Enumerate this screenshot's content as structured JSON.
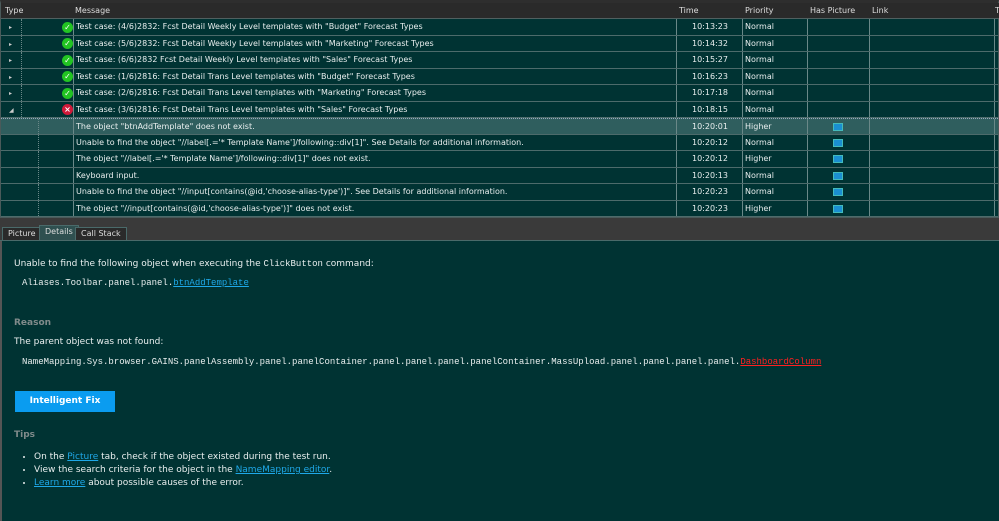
{
  "columns": [
    "Type",
    "Message",
    "Time",
    "Priority",
    "Has Picture",
    "Link",
    "T"
  ],
  "rows": [
    {
      "status": "pass",
      "message": "Test case: (4/6)2832: Fcst Detail Weekly Level templates with \"Budget\" Forecast Types",
      "time": "10:13:23",
      "priority": "Normal",
      "level": 0,
      "expander": "collapsed"
    },
    {
      "status": "pass",
      "message": "Test case: (5/6)2832: Fcst Detail Weekly Level templates with \"Marketing\" Forecast Types",
      "time": "10:14:32",
      "priority": "Normal",
      "level": 0,
      "expander": "collapsed"
    },
    {
      "status": "pass",
      "message": "Test case: (6/6)2832 Fcst Detail Weekly Level templates with \"Sales\" Forecast Types",
      "time": "10:15:27",
      "priority": "Normal",
      "level": 0,
      "expander": "collapsed"
    },
    {
      "status": "pass",
      "message": "Test case: (1/6)2816: Fcst Detail Trans Level templates with \"Budget\" Forecast Types",
      "time": "10:16:23",
      "priority": "Normal",
      "level": 0,
      "expander": "collapsed"
    },
    {
      "status": "pass",
      "message": "Test case: (2/6)2816: Fcst Detail Trans Level templates with \"Marketing\" Forecast Types",
      "time": "10:17:18",
      "priority": "Normal",
      "level": 0,
      "expander": "collapsed"
    },
    {
      "status": "error",
      "message": "Test case: (3/6)2816: Fcst Detail Trans Level templates with \"Sales\" Forecast Types",
      "time": "10:18:15",
      "priority": "Normal",
      "level": 0,
      "expander": "expanded"
    },
    {
      "status": "error",
      "message": "The object \"btnAddTemplate\" does not exist.",
      "time": "10:20:01",
      "priority": "Higher",
      "level": 1,
      "picture": true,
      "selected": true
    },
    {
      "status": "error",
      "message": "Unable to find the object \"//label[.='* Template Name']/following::div[1]\". See Details for additional information.",
      "time": "10:20:12",
      "priority": "Normal",
      "level": 1,
      "picture": true
    },
    {
      "status": "error",
      "message": "The object \"//label[.='* Template Name']/following::div[1]\" does not exist.",
      "time": "10:20:12",
      "priority": "Higher",
      "level": 1,
      "picture": true
    },
    {
      "status": "input",
      "message": "Keyboard input.",
      "time": "10:20:13",
      "priority": "Normal",
      "level": 1,
      "picture": true
    },
    {
      "status": "error",
      "message": "Unable to find the object \"//input[contains(@id,'choose-alias-type')]\". See Details for additional information.",
      "time": "10:20:23",
      "priority": "Normal",
      "level": 1,
      "picture": true
    },
    {
      "status": "error",
      "message": "The object \"//input[contains(@id,'choose-alias-type')]\" does not exist.",
      "time": "10:20:23",
      "priority": "Higher",
      "level": 1,
      "picture": true
    }
  ],
  "tabs": [
    "Picture",
    "Details",
    "Call Stack"
  ],
  "active_tab": "Details",
  "details": {
    "intro_pre": "Unable to find the following object when executing the ",
    "intro_cmd": "ClickButton",
    "intro_post": " command:",
    "alias_path": "Aliases.Toolbar.panel.panel.",
    "alias_link": "btnAddTemplate",
    "reason_heading": "Reason",
    "reason_text": "The parent object was not found:",
    "parent_path": "NameMapping.Sys.browser.GAINS.panelAssembly.panel.panelContainer.panel.panel.panel.panelContainer.MassUpload.panel.panel.panel.panel.",
    "parent_missing": "DashboardColumn",
    "fix_button": "Intelligent Fix",
    "tips_heading": "Tips",
    "tip1_pre": "On the ",
    "tip1_link": "Picture",
    "tip1_post": " tab, check if the object existed during the test run.",
    "tip2_pre": "View the search criteria for the object in the ",
    "tip2_link": "NameMapping editor",
    "tip2_post": ".",
    "tip3_link": "Learn more",
    "tip3_post": " about possible causes of the error."
  },
  "colors": {
    "background": "#003333",
    "selected_row": "#2f5e5e",
    "link": "#1ea8e8",
    "button": "#0a9cf0",
    "missing": "#ff2020"
  }
}
